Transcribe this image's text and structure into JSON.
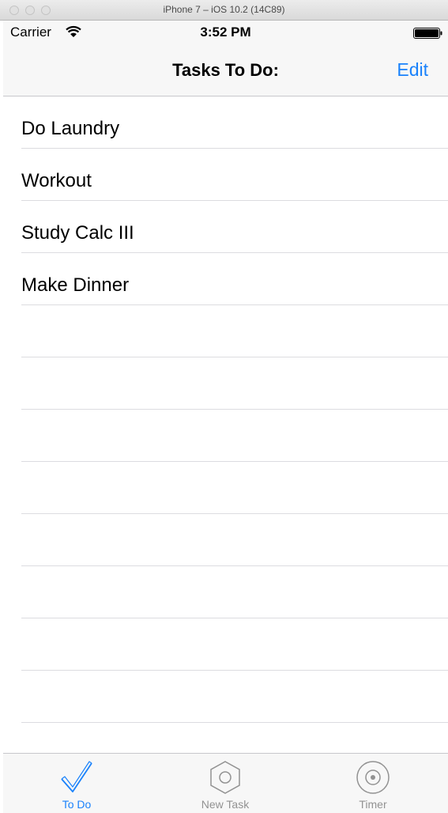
{
  "window": {
    "title": "iPhone 7 – iOS 10.2 (14C89)"
  },
  "status_bar": {
    "carrier": "Carrier",
    "time": "3:52 PM"
  },
  "nav": {
    "title": "Tasks To Do:",
    "edit_label": "Edit"
  },
  "tasks": [
    "Do Laundry",
    "Workout",
    "Study Calc III",
    "Make Dinner"
  ],
  "tab_bar": {
    "tabs": [
      {
        "label": "To Do",
        "icon": "checkmark-icon",
        "active": true
      },
      {
        "label": "New Task",
        "icon": "hexagon-icon",
        "active": false
      },
      {
        "label": "Timer",
        "icon": "timer-icon",
        "active": false
      }
    ]
  },
  "colors": {
    "accent": "#1a82fb",
    "inactive": "#929292"
  }
}
